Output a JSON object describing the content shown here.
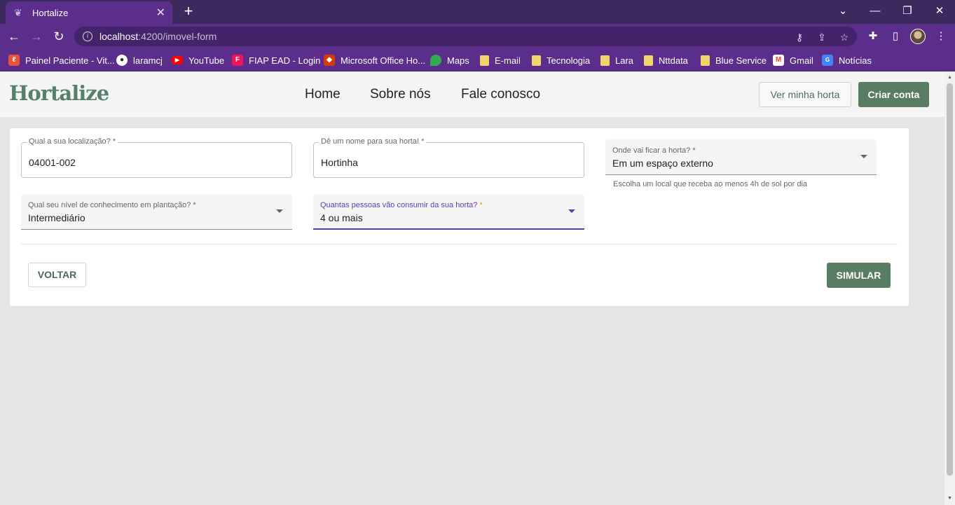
{
  "browser": {
    "tab_title": "Hortalize",
    "url_host": "localhost",
    "url_path": ":4200/imovel-form",
    "bookmarks": [
      {
        "label": "Painel Paciente - Vit...",
        "icon": "painel-icon",
        "color": "#e8543a"
      },
      {
        "label": "laramcj",
        "icon": "github-icon",
        "color": "#222222"
      },
      {
        "label": "YouTube",
        "icon": "youtube-icon",
        "color": "#ff0000"
      },
      {
        "label": "FIAP EAD - Login",
        "icon": "fiap-icon",
        "color": "#ed145b"
      },
      {
        "label": "Microsoft Office Ho...",
        "icon": "office-icon",
        "color": "#d83b01"
      },
      {
        "label": "Maps",
        "icon": "maps-icon",
        "color": "#34a853"
      },
      {
        "label": "E-mail",
        "icon": "folder-icon",
        "color": "#f3d36b"
      },
      {
        "label": "Tecnologia",
        "icon": "folder-icon",
        "color": "#f3d36b"
      },
      {
        "label": "Lara",
        "icon": "folder-icon",
        "color": "#f3d36b"
      },
      {
        "label": "Nttdata",
        "icon": "folder-icon",
        "color": "#f3d36b"
      },
      {
        "label": "Blue Service",
        "icon": "folder-icon",
        "color": "#f3d36b"
      },
      {
        "label": "Gmail",
        "icon": "gmail-icon",
        "color": "#ea4335"
      },
      {
        "label": "Notícias",
        "icon": "news-icon",
        "color": "#4285f4"
      }
    ]
  },
  "header": {
    "logo": "Hortalize",
    "nav": [
      "Home",
      "Sobre nós",
      "Fale conosco"
    ],
    "ver_horta": "Ver minha horta",
    "criar_conta": "Criar conta"
  },
  "form": {
    "localizacao": {
      "label": "Qual a sua localização? *",
      "value": "04001-002"
    },
    "nome_horta": {
      "label": "Dê um nome para sua horta! *",
      "value": "Hortinha"
    },
    "local_horta": {
      "label": "Onde vai ficar a horta? *",
      "value": "Em um espaço externo",
      "hint": "Escolha um local que receba ao menos 4h de sol por dia"
    },
    "conhecimento": {
      "label": "Qual seu nível de conhecimento em plantação? *",
      "value": "Intermediário"
    },
    "pessoas": {
      "label": "Quantas pessoas vão consumir da sua horta?",
      "required_mark": "*",
      "value": "4 ou mais"
    },
    "voltar": "VOLTAR",
    "simular": "SIMULAR"
  },
  "colors": {
    "brand": "#587d63",
    "chrome": "#5b2e8c",
    "focus": "#5b3fa8"
  }
}
